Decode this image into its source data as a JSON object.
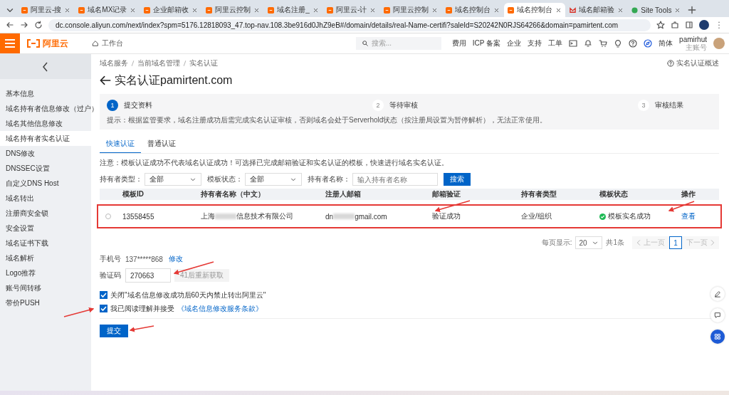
{
  "browser": {
    "tabs": [
      {
        "title": "阿里云-搜",
        "selected": false
      },
      {
        "title": "域名MX记录",
        "selected": false
      },
      {
        "title": "企业邮箱收",
        "selected": false
      },
      {
        "title": "阿里云控制",
        "selected": false
      },
      {
        "title": "域名注册_",
        "selected": false
      },
      {
        "title": "阿里云-计",
        "selected": false
      },
      {
        "title": "阿里云控制",
        "selected": false
      },
      {
        "title": "域名控制台",
        "selected": false
      },
      {
        "title": "域名控制台",
        "selected": true
      },
      {
        "title": "域名邮箱验",
        "selected": false
      },
      {
        "title": "Site Tools",
        "selected": false
      }
    ],
    "address": "dc.console.aliyun.com/next/index?spm=5176.12818093_47.top-nav.108.3be916d0JhZ9eB#/domain/details/real-Name-certifi?saleId=S20242N0RJS64266&domain=pamirtent.com"
  },
  "topbar": {
    "logo": "阿里云",
    "workbench": "工作台",
    "search_placeholder": "搜索...",
    "links": [
      "费用",
      "ICP 备案",
      "企业",
      "支持",
      "工单"
    ],
    "language": "简体",
    "user": "pamirhut",
    "role": "主账号"
  },
  "sidebar": {
    "items": [
      {
        "label": "基本信息",
        "selected": false
      },
      {
        "label": "域名持有者信息修改（过户）",
        "selected": false
      },
      {
        "label": "域名其他信息修改",
        "selected": false
      },
      {
        "label": "域名持有者实名认证",
        "selected": true
      },
      {
        "label": "DNS修改",
        "selected": false
      },
      {
        "label": "DNSSEC设置",
        "selected": false
      },
      {
        "label": "自定义DNS Host",
        "selected": false
      },
      {
        "label": "域名转出",
        "selected": false
      },
      {
        "label": "注册商安全锁",
        "selected": false
      },
      {
        "label": "安全设置",
        "selected": false
      },
      {
        "label": "域名证书下载",
        "selected": false
      },
      {
        "label": "域名解析",
        "selected": false
      },
      {
        "label": "Logo推荐",
        "selected": false
      },
      {
        "label": "账号间转移",
        "selected": false
      },
      {
        "label": "带价PUSH",
        "selected": false
      }
    ]
  },
  "breadcrumb": [
    "域名服务",
    "当前域名管理",
    "实名认证"
  ],
  "help_link": "实名认证概述",
  "title": "实名认证pamirtent.com",
  "steps": [
    {
      "number": "1",
      "label": "提交资料",
      "selected": true
    },
    {
      "number": "2",
      "label": "等待审核",
      "selected": false
    },
    {
      "number": "3",
      "label": "审核结果",
      "selected": false
    }
  ],
  "tip": "提示：根据监管要求，域名注册成功后需完成实名认证审核，否则域名会处于Serverhold状态（按注册局设置为暂停解析），无法正常使用。",
  "form_tabs": [
    {
      "label": "快速认证",
      "selected": true
    },
    {
      "label": "普通认证",
      "selected": false
    }
  ],
  "notice": "注意：模板认证成功不代表域名认证成功！可选择已完成邮箱验证和实名认证的模板，快速进行域名实名认证。",
  "filters": [
    {
      "label": "持有者类型：",
      "value": "全部",
      "kind": "select"
    },
    {
      "label": "模板状态：",
      "value": "全部",
      "kind": "select"
    },
    {
      "label": "持有者名称：",
      "placeholder": "输入持有者名称",
      "kind": "input"
    }
  ],
  "search_button": "搜索",
  "table": {
    "columns": [
      "模板ID",
      "持有者名称（中文）",
      "注册人邮箱",
      "邮箱验证",
      "持有者类型",
      "模板状态",
      "操作"
    ],
    "rows": [
      {
        "selected": false,
        "id": "13558455",
        "holder_start": "上海",
        "holder_end": "信息技术有限公司",
        "email_start": "dn",
        "email_end": "gmail.com",
        "email_verification": "验证成功",
        "holder_type": "企业/组织",
        "status": "模板实名成功",
        "action": "查看"
      }
    ]
  },
  "pagination": {
    "page_size_label": "每页显示:",
    "page_size": "20",
    "total": "共1条",
    "prev": "上一页",
    "pages": [
      {
        "label": "1",
        "selected": true
      }
    ],
    "next": "下一页"
  },
  "phone": {
    "label": "手机号",
    "value": "137*****868",
    "edit": "修改"
  },
  "code": {
    "label": "验证码",
    "value": "270663",
    "resend": "41后重新获取",
    "resend_disabled": true
  },
  "checkboxes": [
    {
      "text": "关闭\"域名信息修改成功后60天内禁止转出阿里云\"",
      "checked": true
    },
    {
      "text": "我已阅读理解并接受",
      "link": "《域名信息修改服务条款》",
      "checked": true
    }
  ],
  "submit": "提交"
}
